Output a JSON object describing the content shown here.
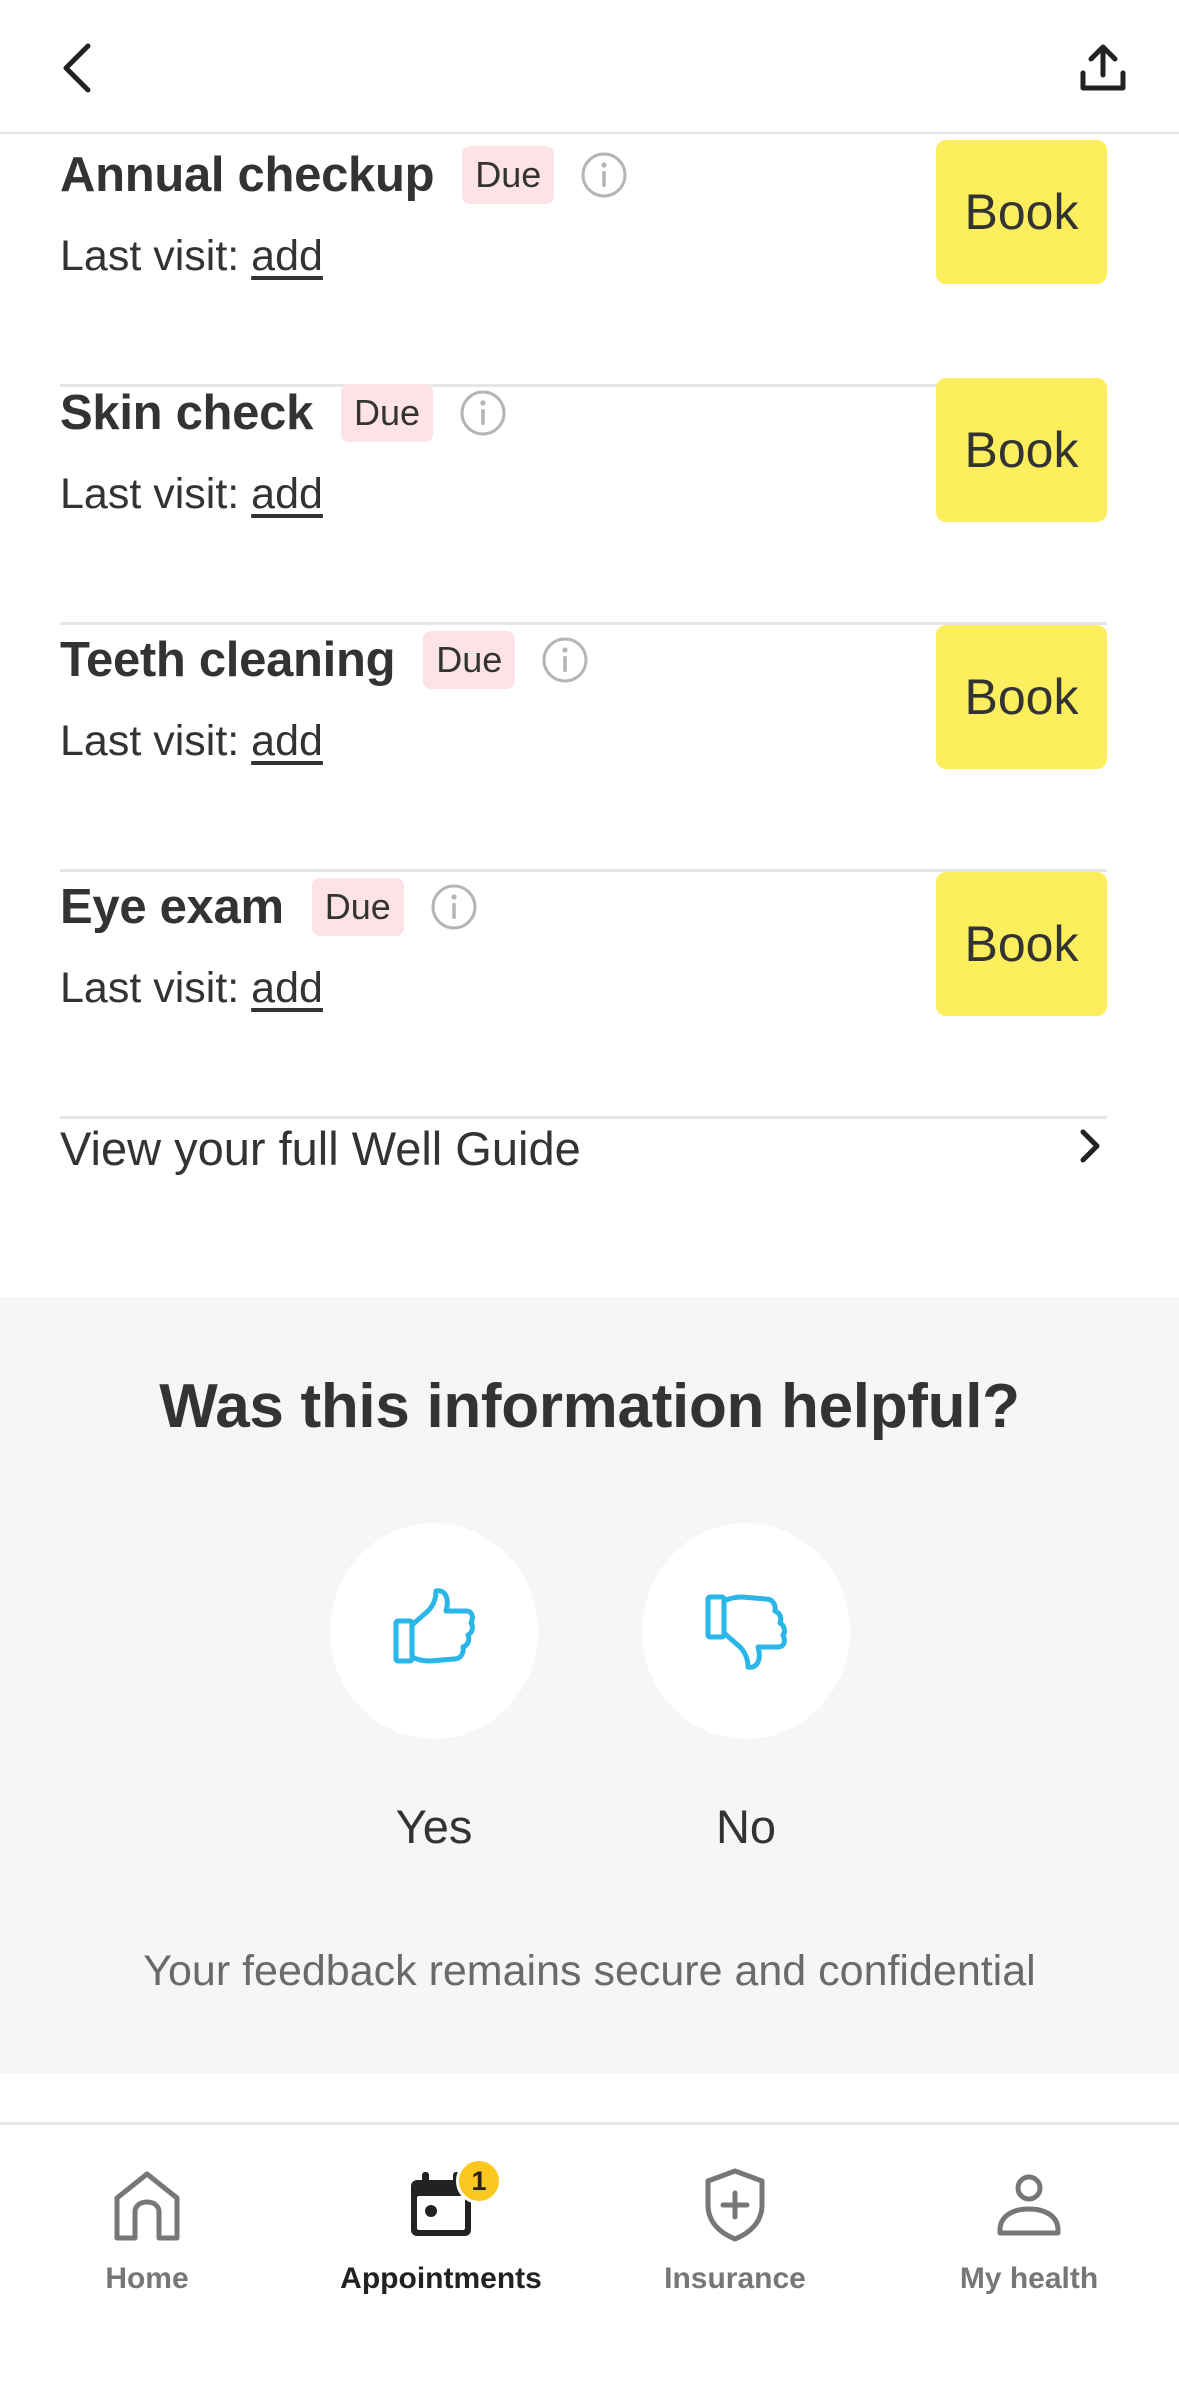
{
  "header": {
    "back_icon": "chevron-left-icon",
    "share_icon": "share-upload-icon"
  },
  "care_items": [
    {
      "title": "Annual checkup",
      "badge": "Due",
      "last_visit_label": "Last visit: ",
      "last_visit_link": "add",
      "book_label": "Book"
    },
    {
      "title": "Skin check",
      "badge": "Due",
      "last_visit_label": "Last visit: ",
      "last_visit_link": "add",
      "book_label": "Book"
    },
    {
      "title": "Teeth cleaning",
      "badge": "Due",
      "last_visit_label": "Last visit: ",
      "last_visit_link": "add",
      "book_label": "Book"
    },
    {
      "title": "Eye exam",
      "badge": "Due",
      "last_visit_label": "Last visit: ",
      "last_visit_link": "add",
      "book_label": "Book"
    }
  ],
  "guide_link": {
    "label": "View your full Well Guide",
    "icon": "chevron-right-icon"
  },
  "feedback": {
    "title": "Was this information helpful?",
    "yes_label": "Yes",
    "no_label": "No",
    "note": "Your feedback remains secure and confidential",
    "icon_color": "#2bb6e8"
  },
  "bottom_nav": {
    "items": [
      {
        "label": "Home",
        "icon": "home-icon"
      },
      {
        "label": "Appointments",
        "icon": "calendar-icon",
        "badge": "1",
        "active": true
      },
      {
        "label": "Insurance",
        "icon": "shield-plus-icon"
      },
      {
        "label": "My health",
        "icon": "person-icon"
      }
    ]
  },
  "colors": {
    "book_button": "#fdee5e",
    "due_badge": "#fde3e6",
    "feedback_bg": "#f7f6f4",
    "nav_badge": "#fcc81f"
  }
}
